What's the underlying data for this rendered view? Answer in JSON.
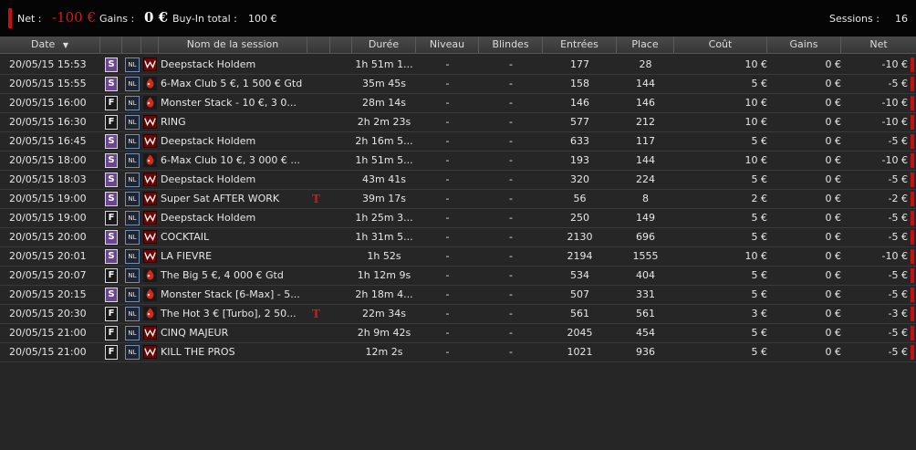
{
  "top": {
    "net_label": "Net :",
    "net_value": "-100 €",
    "gains_label": "Gains :",
    "gains_value": "0 €",
    "buyin_label": "Buy-In total :",
    "buyin_value": "100 €",
    "sessions_label": "Sessions :",
    "sessions_value": "16"
  },
  "colors": {
    "negative": "#c41010",
    "header_bg": "#3e3e3e",
    "row_bg": "#262626"
  },
  "headers": {
    "date": "Date",
    "name": "Nom de la session",
    "duree": "Durée",
    "niveau": "Niveau",
    "blindes": "Blindes",
    "entrees": "Entrées",
    "place": "Place",
    "cout": "Coût",
    "gains": "Gains",
    "net": "Net"
  },
  "rows": [
    {
      "date": "20/05/15 15:53",
      "type": "S",
      "nl": "NL",
      "room": "winamax",
      "name": "Deepstack Holdem",
      "turbo": false,
      "duree": "1h 51m 1...",
      "niveau": "-",
      "blindes": "-",
      "entrees": "177",
      "place": "28",
      "cout": "10 €",
      "gains": "0 €",
      "net": "-10 €"
    },
    {
      "date": "20/05/15 15:55",
      "type": "S",
      "nl": "NL",
      "room": "pokerstars",
      "name": "6-Max Club 5 €, 1 500 € Gtd",
      "turbo": false,
      "duree": "35m 45s",
      "niveau": "-",
      "blindes": "-",
      "entrees": "158",
      "place": "144",
      "cout": "5 €",
      "gains": "0 €",
      "net": "-5 €"
    },
    {
      "date": "20/05/15 16:00",
      "type": "F",
      "nl": "NL",
      "room": "pokerstars",
      "name": "Monster Stack - 10 €, 3 0...",
      "turbo": false,
      "duree": "28m 14s",
      "niveau": "-",
      "blindes": "-",
      "entrees": "146",
      "place": "146",
      "cout": "10 €",
      "gains": "0 €",
      "net": "-10 €"
    },
    {
      "date": "20/05/15 16:30",
      "type": "F",
      "nl": "NL",
      "room": "winamax",
      "name": "RING",
      "turbo": false,
      "duree": "2h 2m 23s",
      "niveau": "-",
      "blindes": "-",
      "entrees": "577",
      "place": "212",
      "cout": "10 €",
      "gains": "0 €",
      "net": "-10 €"
    },
    {
      "date": "20/05/15 16:45",
      "type": "S",
      "nl": "NL",
      "room": "winamax",
      "name": "Deepstack Holdem",
      "turbo": false,
      "duree": "2h 16m 5...",
      "niveau": "-",
      "blindes": "-",
      "entrees": "633",
      "place": "117",
      "cout": "5 €",
      "gains": "0 €",
      "net": "-5 €"
    },
    {
      "date": "20/05/15 18:00",
      "type": "S",
      "nl": "NL",
      "room": "pokerstars",
      "name": "6-Max Club 10 €, 3 000 € ...",
      "turbo": false,
      "duree": "1h 51m 5...",
      "niveau": "-",
      "blindes": "-",
      "entrees": "193",
      "place": "144",
      "cout": "10 €",
      "gains": "0 €",
      "net": "-10 €"
    },
    {
      "date": "20/05/15 18:03",
      "type": "S",
      "nl": "NL",
      "room": "winamax",
      "name": "Deepstack Holdem",
      "turbo": false,
      "duree": "43m 41s",
      "niveau": "-",
      "blindes": "-",
      "entrees": "320",
      "place": "224",
      "cout": "5 €",
      "gains": "0 €",
      "net": "-5 €"
    },
    {
      "date": "20/05/15 19:00",
      "type": "S",
      "nl": "NL",
      "room": "winamax",
      "name": "Super Sat AFTER WORK",
      "turbo": true,
      "duree": "39m 17s",
      "niveau": "-",
      "blindes": "-",
      "entrees": "56",
      "place": "8",
      "cout": "2 €",
      "gains": "0 €",
      "net": "-2 €"
    },
    {
      "date": "20/05/15 19:00",
      "type": "F",
      "nl": "NL",
      "room": "winamax",
      "name": "Deepstack Holdem",
      "turbo": false,
      "duree": "1h 25m 3...",
      "niveau": "-",
      "blindes": "-",
      "entrees": "250",
      "place": "149",
      "cout": "5 €",
      "gains": "0 €",
      "net": "-5 €"
    },
    {
      "date": "20/05/15 20:00",
      "type": "S",
      "nl": "NL",
      "room": "winamax",
      "name": "COCKTAIL",
      "turbo": false,
      "duree": "1h 31m 5...",
      "niveau": "-",
      "blindes": "-",
      "entrees": "2130",
      "place": "696",
      "cout": "5 €",
      "gains": "0 €",
      "net": "-5 €"
    },
    {
      "date": "20/05/15 20:01",
      "type": "S",
      "nl": "NL",
      "room": "winamax",
      "name": "LA FIEVRE",
      "turbo": false,
      "duree": "1h 52s",
      "niveau": "-",
      "blindes": "-",
      "entrees": "2194",
      "place": "1555",
      "cout": "10 €",
      "gains": "0 €",
      "net": "-10 €"
    },
    {
      "date": "20/05/15 20:07",
      "type": "F",
      "nl": "NL",
      "room": "pokerstars",
      "name": "The Big 5 €, 4 000 € Gtd",
      "turbo": false,
      "duree": "1h 12m 9s",
      "niveau": "-",
      "blindes": "-",
      "entrees": "534",
      "place": "404",
      "cout": "5 €",
      "gains": "0 €",
      "net": "-5 €"
    },
    {
      "date": "20/05/15 20:15",
      "type": "S",
      "nl": "NL",
      "room": "pokerstars",
      "name": "Monster Stack [6-Max] - 5...",
      "turbo": false,
      "duree": "2h 18m 4...",
      "niveau": "-",
      "blindes": "-",
      "entrees": "507",
      "place": "331",
      "cout": "5 €",
      "gains": "0 €",
      "net": "-5 €"
    },
    {
      "date": "20/05/15 20:30",
      "type": "F",
      "nl": "NL",
      "room": "pokerstars",
      "name": "The Hot 3 € [Turbo], 2 50...",
      "turbo": true,
      "duree": "22m 34s",
      "niveau": "-",
      "blindes": "-",
      "entrees": "561",
      "place": "561",
      "cout": "3 €",
      "gains": "0 €",
      "net": "-3 €"
    },
    {
      "date": "20/05/15 21:00",
      "type": "F",
      "nl": "NL",
      "room": "winamax",
      "name": "CINQ MAJEUR",
      "turbo": false,
      "duree": "2h 9m 42s",
      "niveau": "-",
      "blindes": "-",
      "entrees": "2045",
      "place": "454",
      "cout": "5 €",
      "gains": "0 €",
      "net": "-5 €"
    },
    {
      "date": "20/05/15 21:00",
      "type": "F",
      "nl": "NL",
      "room": "winamax",
      "name": "KILL THE PROS",
      "turbo": false,
      "duree": "12m 2s",
      "niveau": "-",
      "blindes": "-",
      "entrees": "1021",
      "place": "936",
      "cout": "5 €",
      "gains": "0 €",
      "net": "-5 €"
    }
  ]
}
